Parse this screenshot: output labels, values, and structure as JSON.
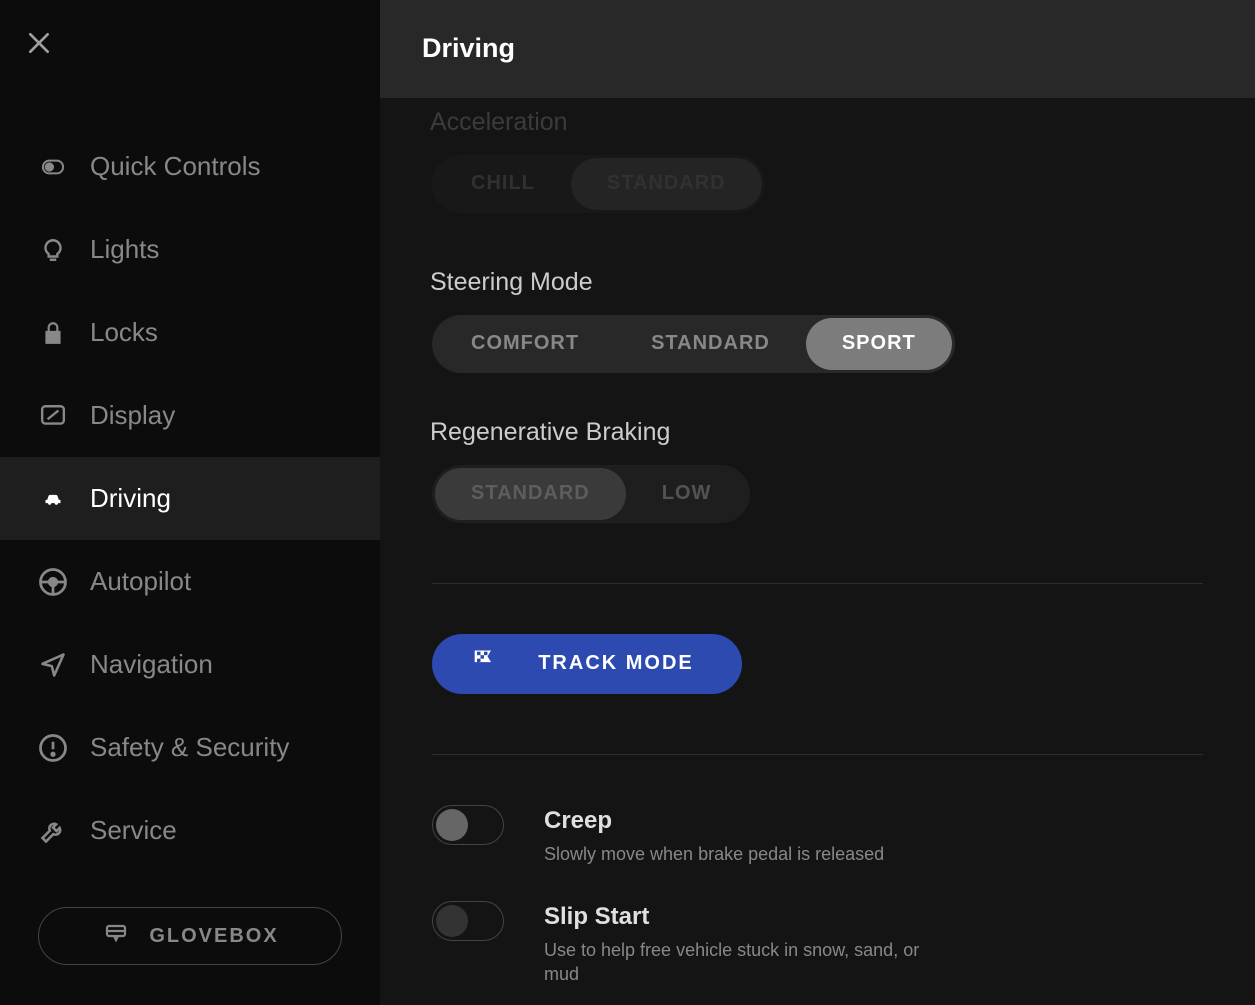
{
  "header": {
    "title": "Driving"
  },
  "sidebar": {
    "items": [
      {
        "label": "Quick Controls"
      },
      {
        "label": "Lights"
      },
      {
        "label": "Locks"
      },
      {
        "label": "Display"
      },
      {
        "label": "Driving"
      },
      {
        "label": "Autopilot"
      },
      {
        "label": "Navigation"
      },
      {
        "label": "Safety & Security"
      },
      {
        "label": "Service"
      }
    ],
    "glovebox_label": "GLOVEBOX"
  },
  "acceleration": {
    "label": "Acceleration",
    "options": [
      "CHILL",
      "STANDARD"
    ],
    "selected": 1
  },
  "steering": {
    "label": "Steering Mode",
    "options": [
      "COMFORT",
      "STANDARD",
      "SPORT"
    ],
    "selected": 2
  },
  "regen": {
    "label": "Regenerative Braking",
    "options": [
      "STANDARD",
      "LOW"
    ],
    "selected": 0
  },
  "track_mode": {
    "label": "TRACK MODE"
  },
  "toggles": {
    "creep": {
      "title": "Creep",
      "desc": "Slowly move when brake pedal is released",
      "on": false
    },
    "slip": {
      "title": "Slip Start",
      "desc": "Use to help free vehicle stuck in snow, sand, or mud",
      "on": false
    }
  }
}
